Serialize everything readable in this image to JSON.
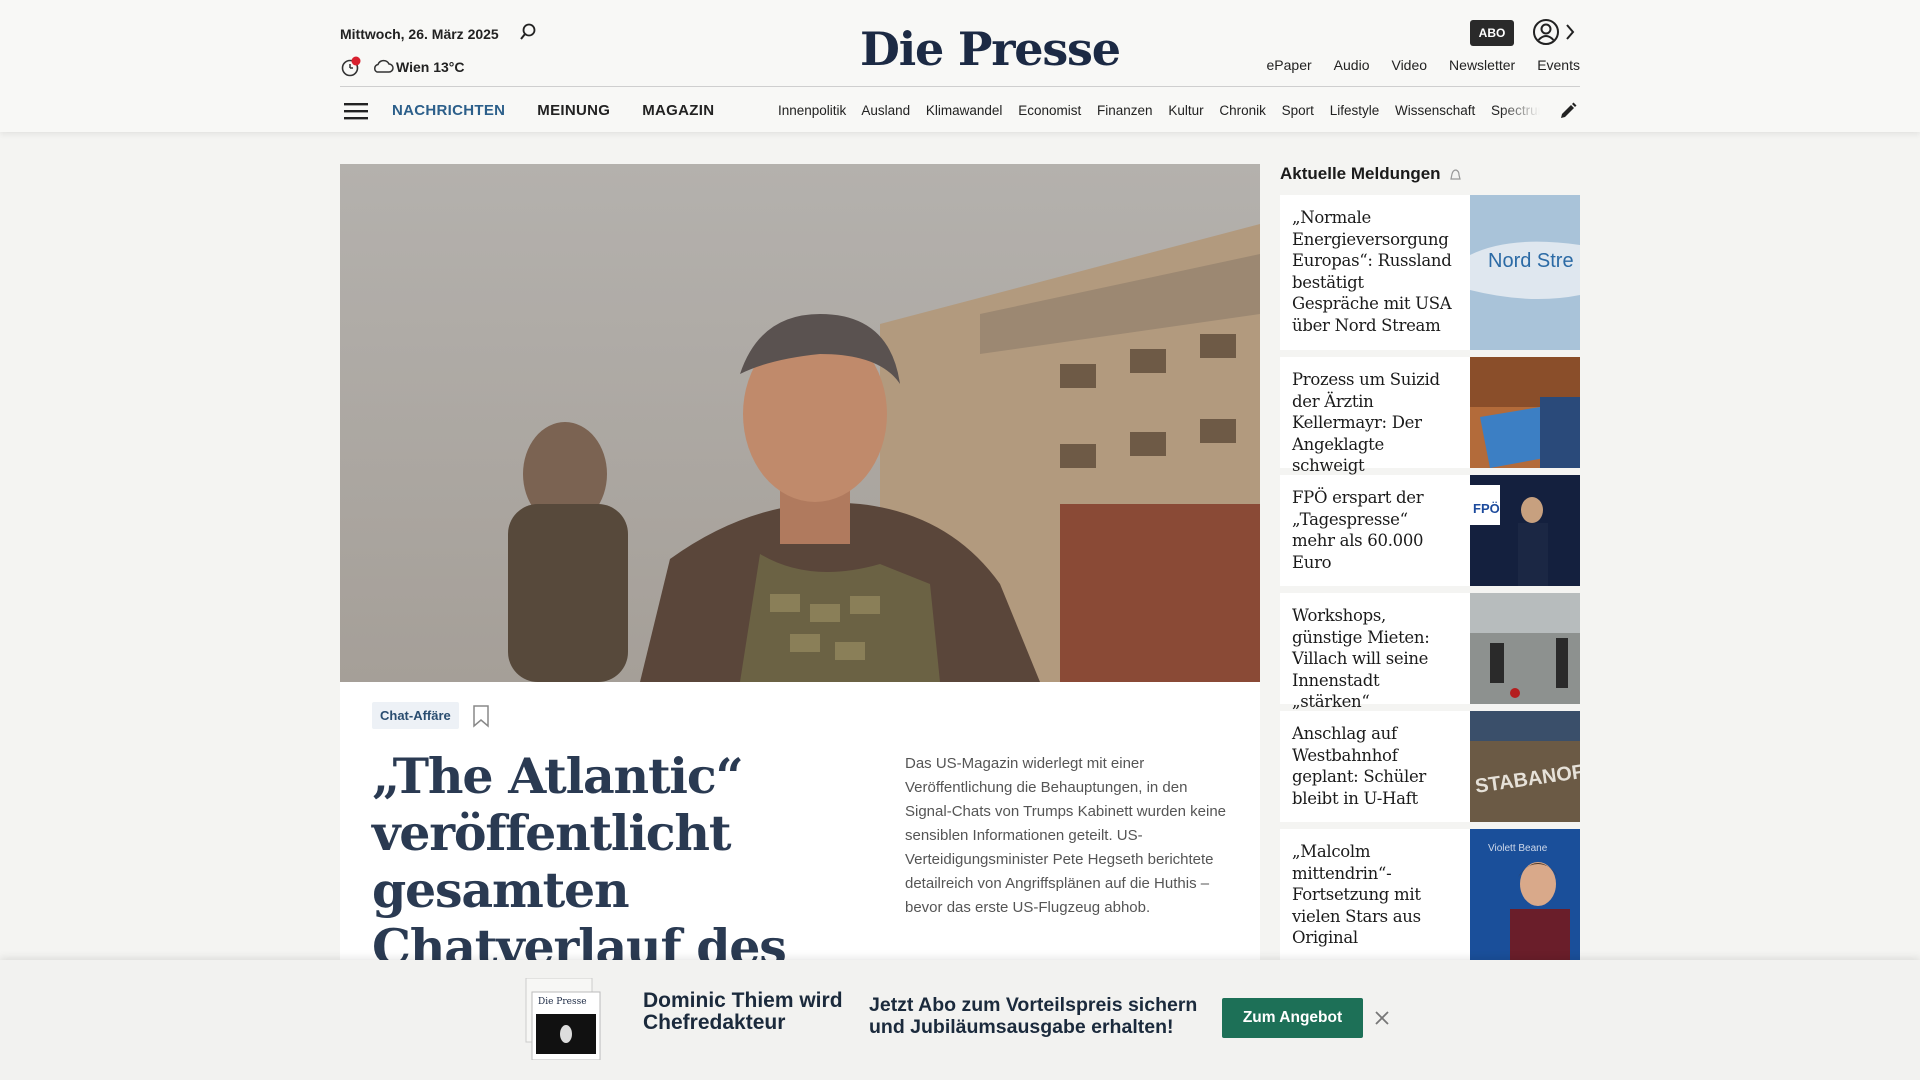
{
  "header": {
    "date": "Mittwoch, 26. März 2025",
    "weather": "Wien 13°C",
    "logo": "Die Presse",
    "abo_label": "ABO",
    "utility_links": [
      "ePaper",
      "Audio",
      "Video",
      "Newsletter",
      "Events"
    ],
    "main_nav": [
      "NACHRICHTEN",
      "MEINUNG",
      "MAGAZIN"
    ],
    "active_nav": "NACHRICHTEN",
    "sub_nav": [
      "Innenpolitik",
      "Ausland",
      "Klimawandel",
      "Economist",
      "Finanzen",
      "Kultur",
      "Chronik",
      "Sport",
      "Lifestyle",
      "Wissenschaft",
      "Spectrum"
    ]
  },
  "lead": {
    "tag": "Chat-Affäre",
    "headline": "„The Atlantic“ veröffentlicht gesamten Chatverlauf des Trump-Kabinetts",
    "teaser": "Das US-Magazin widerlegt mit einer Veröffentlichung die Behauptungen, in den Signal-Chats von Trumps Kabinett wurden keine sensiblen Informationen geteilt. US-Verteidigungsminister Pete Hegseth berichtete detailreich von Angriffsplänen auf die Huthis – bevor das erste US-Flugzeug abhob."
  },
  "sidebar": {
    "title": "Aktuelle Meldungen",
    "items": [
      {
        "text": "„Normale Energieversorgung Europas“: Russland bestätigt Gespräche mit USA über Nord Stream",
        "image_text": "Nord Stre"
      },
      {
        "text": "Prozess um Suizid der Ärztin Kellermayr: Der Angeklagte schweigt"
      },
      {
        "text": "FPÖ erspart der „Tagespresse“ mehr als 60.000 Euro",
        "image_text": "FPÖ"
      },
      {
        "text": "Workshops, günstige Mieten: Villach will seine Innenstadt „stärken“"
      },
      {
        "text": "Anschlag auf Westbahnhof geplant: Schüler bleibt in U-Haft",
        "image_text": "STABANOF"
      },
      {
        "text": "„Malcolm mittendrin“-Fortsetzung mit vielen Stars aus Original",
        "image_text": "Violett Beane"
      }
    ]
  },
  "promo": {
    "headline": "Dominic Thiem wird Chefredakteur",
    "text": "Jetzt Abo zum Vorteilspreis sichern und Jubiläumsausgabe erhalten!",
    "button": "Zum Angebot",
    "thumb_label": "Die Presse"
  },
  "colors": {
    "brand": "#1c2a44",
    "nav_active": "#2c5f8a",
    "promo_button": "#1d7057",
    "headline": "#2a3a52"
  }
}
